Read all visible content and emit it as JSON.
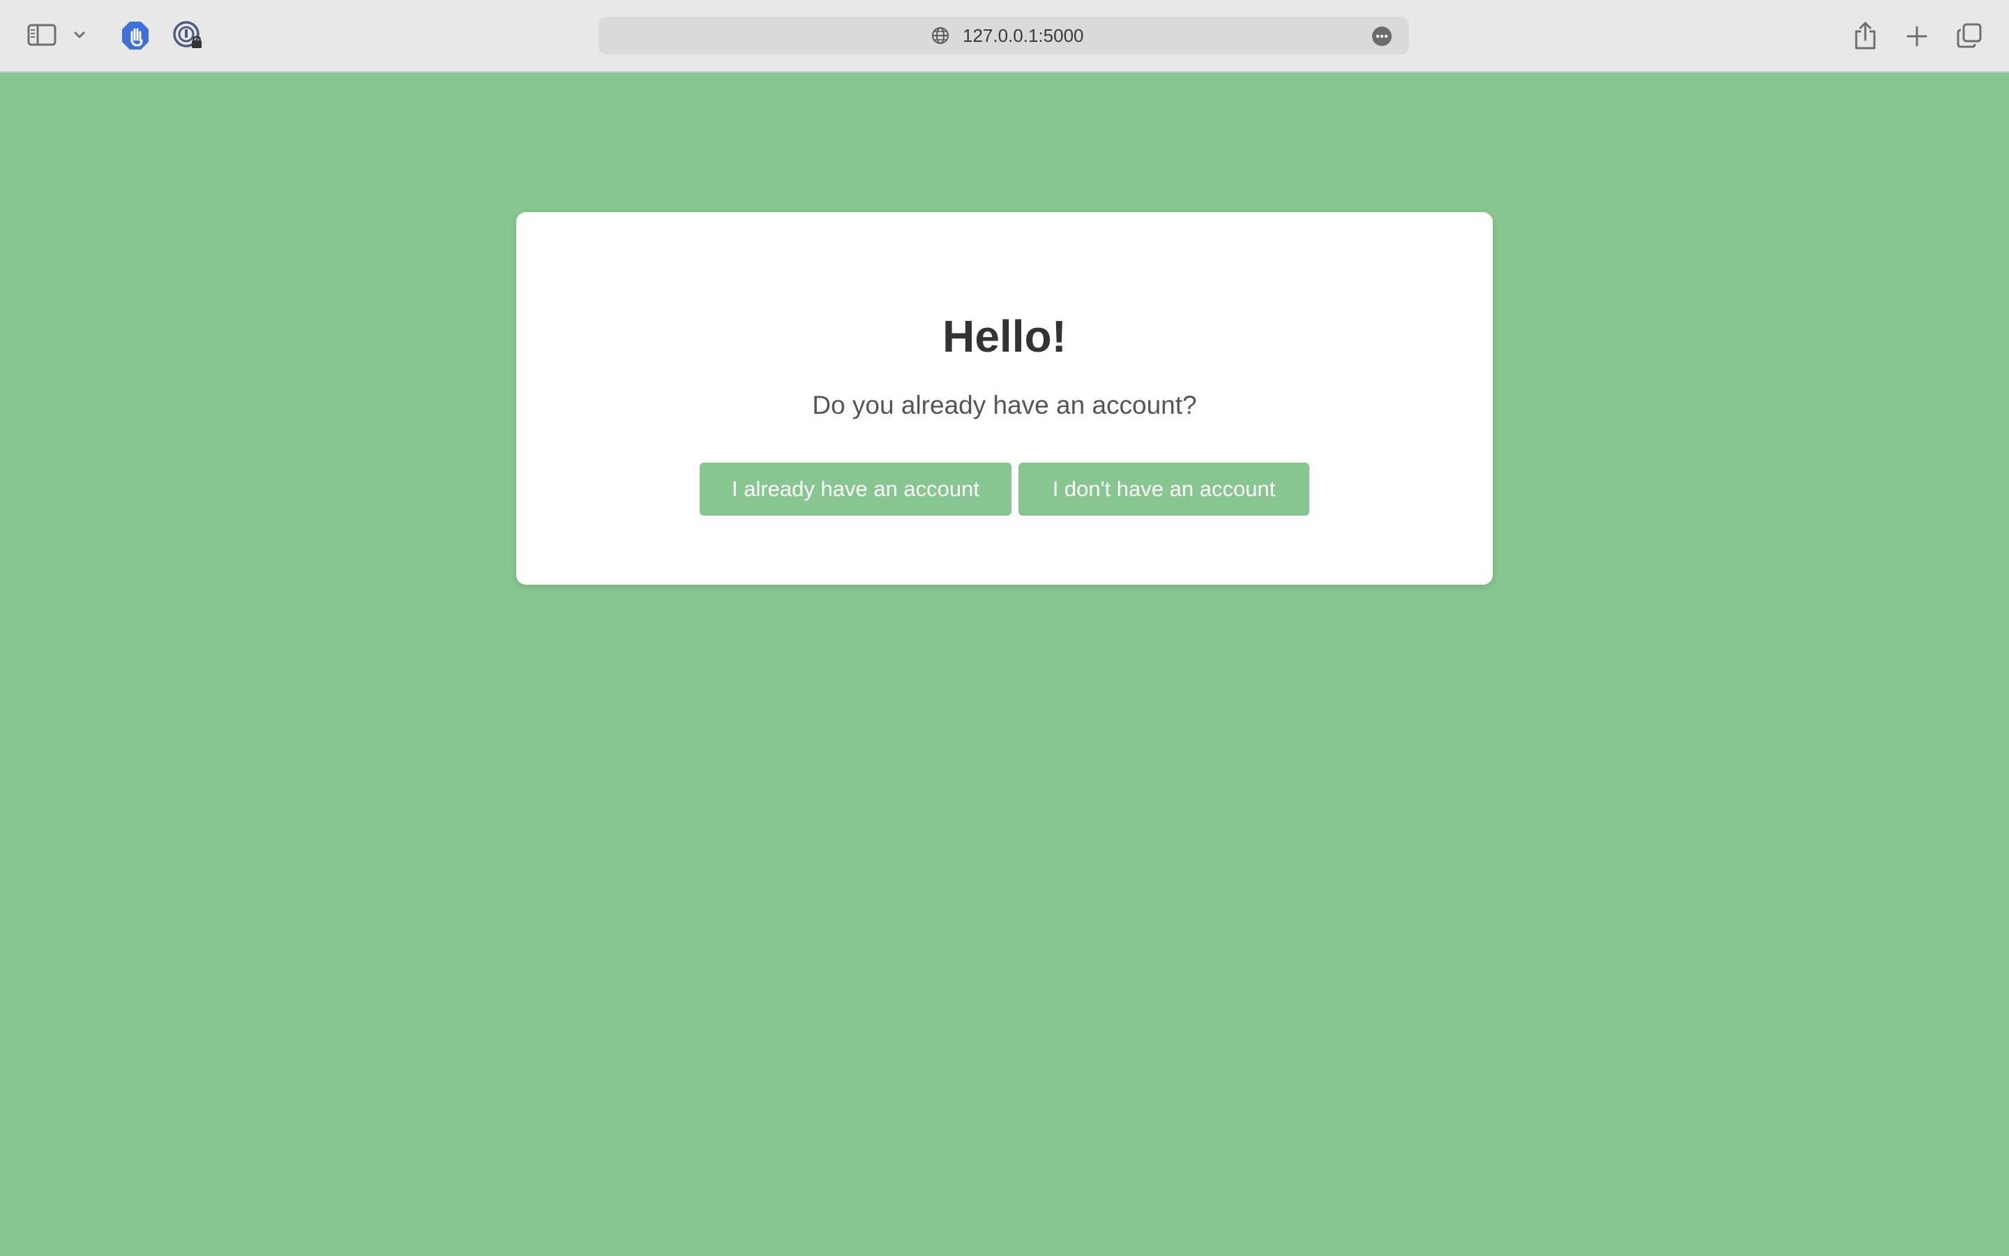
{
  "browser": {
    "address": "127.0.0.1:5000",
    "icons": {
      "sidebar": "sidebar-icon",
      "chevron": "chevron-down-icon",
      "adblock": "hand-stop-icon",
      "password": "password-lock-icon",
      "globe": "globe-icon",
      "more": "more-options-icon",
      "share": "share-icon",
      "new_tab": "plus-icon",
      "tabs": "tab-overview-icon"
    }
  },
  "card": {
    "title": "Hello!",
    "question": "Do you already have an account?",
    "buttons": {
      "existing": "I already have an account",
      "new": "I don't have an account"
    }
  },
  "colors": {
    "page_background": "#87c690",
    "button_background": "#87c690",
    "card_background": "#ffffff",
    "toolbar_background": "#e7e8e7"
  }
}
